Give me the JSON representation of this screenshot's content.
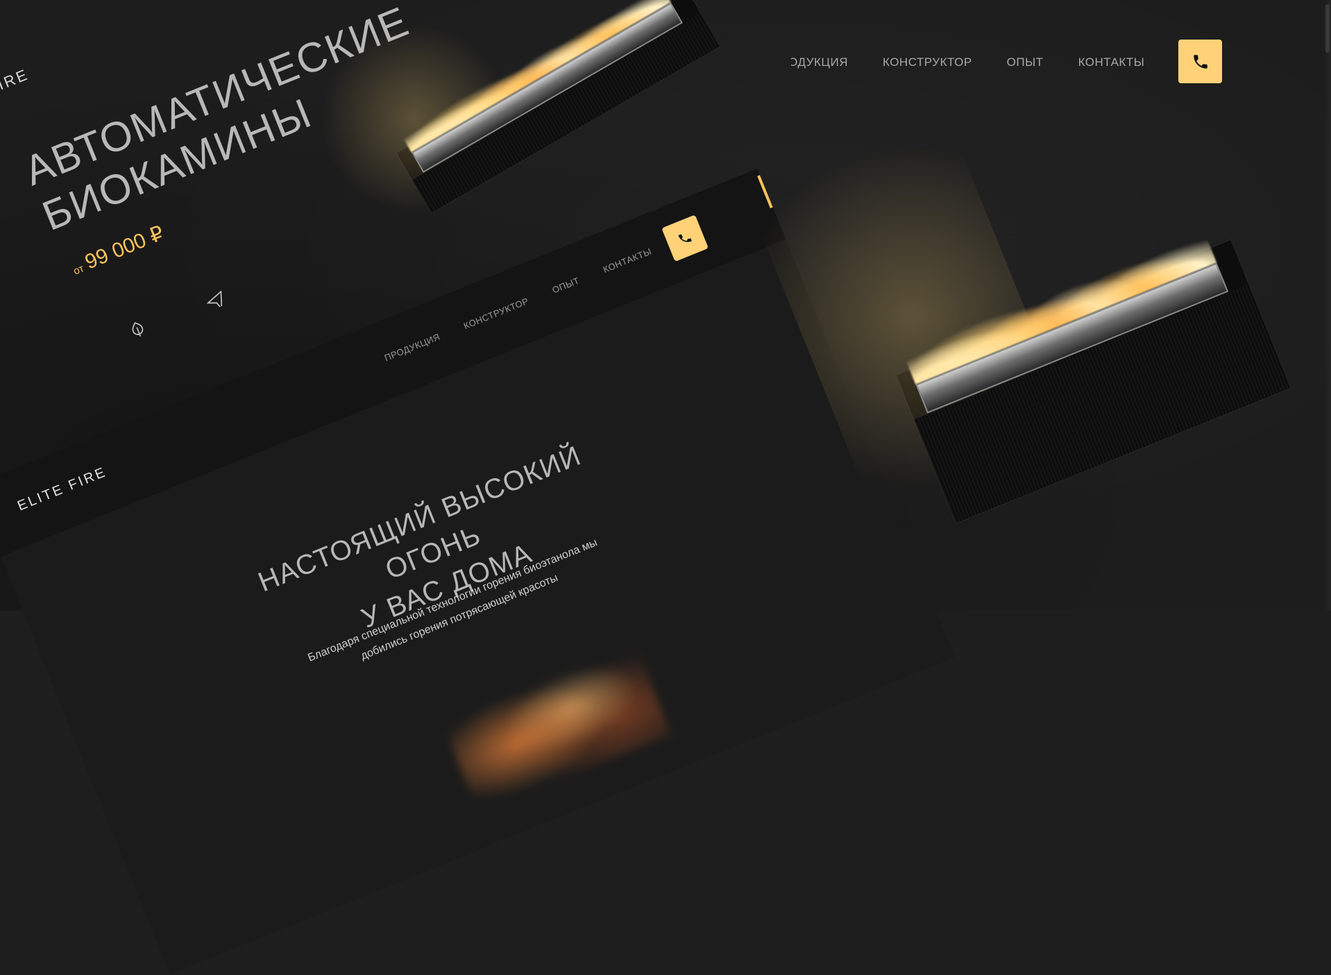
{
  "top_nav": {
    "items": [
      "ПРОДУКЦИЯ",
      "КОНСТРУКТОР",
      "ОПЫТ",
      "КОНТАКТЫ"
    ]
  },
  "card_back": {
    "brand": "IRE",
    "hero_title_line1": "АВТОМАТИЧЕСКИЕ",
    "hero_title_line2": "БИОКАМИНЫ",
    "price_prefix": "от",
    "price": "99 000 ₽"
  },
  "card_front": {
    "brand": "ELITE FIRE",
    "nav": [
      "ПРОДУКЦИЯ",
      "КОНСТРУКТОР",
      "ОПЫТ",
      "КОНТАКТЫ"
    ],
    "headline_line1": "НАСТОЯЩИЙ ВЫСОКИЙ ОГОНЬ",
    "headline_line2": "У ВАС ДОМА",
    "subtext_line1": "Благодаря специальной технологии горения биоэтанола мы",
    "subtext_line2": "добились горения потрясающей красоты"
  },
  "colors": {
    "accent": "#ffd278",
    "price": "#ffc25a",
    "background": "#1e1e1e"
  },
  "icons": [
    "phone-icon",
    "leaf-icon",
    "plane-icon"
  ]
}
